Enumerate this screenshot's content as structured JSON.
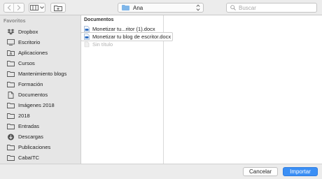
{
  "toolbar": {
    "location": "Ana",
    "search_placeholder": "Buscar"
  },
  "sidebar": {
    "heading": "Favoritos",
    "items": [
      {
        "label": "Dropbox",
        "icon": "dropbox-icon"
      },
      {
        "label": "Escritorio",
        "icon": "desktop-icon"
      },
      {
        "label": "Aplicaciones",
        "icon": "applications-icon"
      },
      {
        "label": "Cursos",
        "icon": "folder-icon"
      },
      {
        "label": "Mantenimiento blogs",
        "icon": "folder-icon"
      },
      {
        "label": "Formación",
        "icon": "folder-icon"
      },
      {
        "label": "Documentos",
        "icon": "documents-icon"
      },
      {
        "label": "Imágenes 2018",
        "icon": "folder-icon"
      },
      {
        "label": "2018",
        "icon": "folder-icon"
      },
      {
        "label": "Entradas",
        "icon": "folder-icon"
      },
      {
        "label": "Descargas",
        "icon": "downloads-icon"
      },
      {
        "label": "Publicaciones",
        "icon": "folder-icon"
      },
      {
        "label": "CabaITC",
        "icon": "folder-icon"
      }
    ]
  },
  "column": {
    "header": "Documentos",
    "files": [
      {
        "label": "Monetizar tu...ritor (1).docx",
        "icon": "docx-icon",
        "state": "normal"
      },
      {
        "label": "Monetizar tu blog de escritor.docx",
        "icon": "docx-icon",
        "state": "selected"
      },
      {
        "label": "Sin título",
        "icon": "dim-file-icon",
        "state": "dim"
      }
    ]
  },
  "buttons": {
    "cancel": "Cancelar",
    "import": "Importar"
  },
  "colors": {
    "accent": "#3b8ff5",
    "folder": "#7fb6e9"
  }
}
